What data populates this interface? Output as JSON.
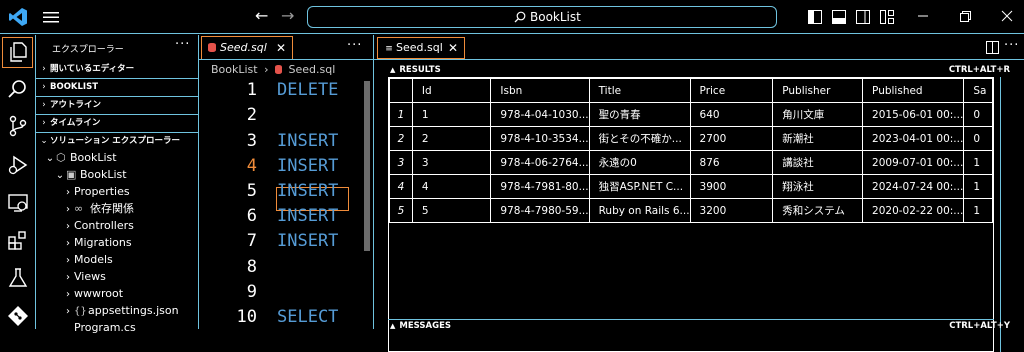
{
  "titlebar": {
    "search_text": "BookList"
  },
  "explorer": {
    "header": "エクスプローラー",
    "sections": [
      "開いているエディター",
      "BOOKLIST",
      "アウトライン",
      "タイムライン",
      "ソリューション エクスプローラー"
    ],
    "tree": [
      "BookList",
      "BookList",
      "Properties",
      "依存関係",
      "Controllers",
      "Migrations",
      "Models",
      "Views",
      "wwwroot",
      "appsettings.json",
      "Program.cs"
    ]
  },
  "editor": {
    "tab_label": "Seed.sql",
    "breadcrumb_project": "BookList",
    "breadcrumb_file": "Seed.sql",
    "lines": [
      {
        "n": "1",
        "code": "DELETE"
      },
      {
        "n": "2",
        "code": ""
      },
      {
        "n": "3",
        "code": "INSERT"
      },
      {
        "n": "4",
        "code": "INSERT"
      },
      {
        "n": "5",
        "code": "INSERT"
      },
      {
        "n": "6",
        "code": "INSERT"
      },
      {
        "n": "7",
        "code": "INSERT"
      },
      {
        "n": "8",
        "code": ""
      },
      {
        "n": "9",
        "code": ""
      },
      {
        "n": "10",
        "code": "SELECT"
      }
    ]
  },
  "results": {
    "tab_label": "Seed.sql",
    "header": "RESULTS",
    "shortcut": "CTRL+ALT+R",
    "messages_header": "MESSAGES",
    "messages_shortcut": "CTRL+ALT+Y",
    "columns": [
      "",
      "Id",
      "Isbn",
      "Title",
      "Price",
      "Publisher",
      "Published",
      "Sa"
    ],
    "rows": [
      [
        "1",
        "1",
        "978-4-04-1030...",
        "聖の青春",
        "640",
        "角川文庫",
        "2015-06-01 00:...",
        "0"
      ],
      [
        "2",
        "2",
        "978-4-10-3534...",
        "街とその不確か...",
        "2700",
        "新潮社",
        "2023-04-01 00:...",
        "0"
      ],
      [
        "3",
        "3",
        "978-4-06-2764...",
        "永遠の0",
        "876",
        "講談社",
        "2009-07-01 00:...",
        "1"
      ],
      [
        "4",
        "4",
        "978-4-7981-80...",
        "独習ASP.NET C...",
        "3900",
        "翔泳社",
        "2024-07-24 00:...",
        "1"
      ],
      [
        "5",
        "5",
        "978-4-7980-59...",
        "Ruby on Rails 6...",
        "3200",
        "秀和システム",
        "2020-02-22 00:...",
        "1"
      ]
    ]
  },
  "colors": {
    "accent": "#6fc3df",
    "active_border": "#f08c3a",
    "keyword": "#569cd6",
    "logo": "#3ea8f5",
    "sql_icon": "#e5534b"
  }
}
